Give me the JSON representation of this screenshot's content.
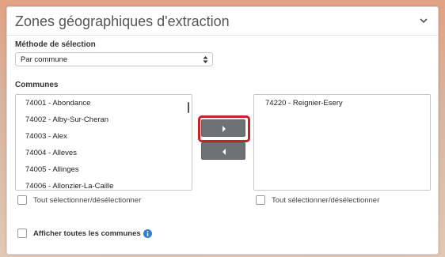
{
  "panel": {
    "title": "Zones géographiques d'extraction"
  },
  "method": {
    "label": "Méthode de sélection",
    "value": "Par commune"
  },
  "communes": {
    "label": "Communes",
    "available": [
      "74001 - Abondance",
      "74002 - Alby-Sur-Cheran",
      "74003 - Alex",
      "74004 - Alleves",
      "74005 - Allinges",
      "74006 - Allonzier-La-Caille"
    ],
    "selected": [
      "74220 - Reignier-Esery"
    ],
    "select_all_left": "Tout sélectionner/désélectionner",
    "select_all_right": "Tout sélectionner/désélectionner",
    "show_all": "Afficher toutes les communes"
  },
  "colors": {
    "highlight": "#cc1f26",
    "button": "#6f7275",
    "info": "#2f7fd3"
  },
  "icons": [
    "chevron-down-icon",
    "select-arrows-icon",
    "arrow-right-icon",
    "arrow-left-icon",
    "info-icon"
  ]
}
